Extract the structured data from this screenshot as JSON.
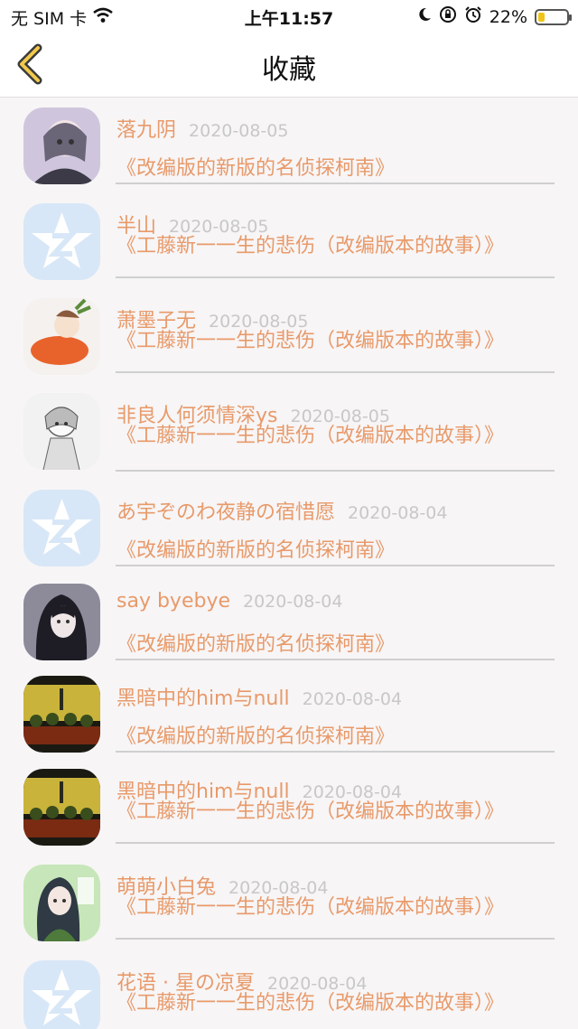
{
  "status_bar": {
    "carrier": "无 SIM 卡",
    "time": "上午11:57",
    "battery": "22%"
  },
  "nav": {
    "title": "收藏"
  },
  "items": [
    {
      "name": "落九阴",
      "date": "2020-08-05",
      "title": "《改编版的新版的名侦探柯南》",
      "avatar": "anime-girl-avatar"
    },
    {
      "name": "半山",
      "date": "2020-08-05",
      "title": "《工藤新一一生的悲伤（改编版本的故事）》",
      "avatar": "default-qq-avatar"
    },
    {
      "name": "萧墨子无",
      "date": "2020-08-05",
      "title": "《工藤新一一生的悲伤（改编版本的故事）》",
      "avatar": "carrot-avatar"
    },
    {
      "name": "非良人何须情深ys",
      "date": "2020-08-05",
      "title": "《工藤新一一生的悲伤（改编版本的故事）》",
      "avatar": "sketch-avatar"
    },
    {
      "name": "あ宇ぞのわ夜静の宿惜愿",
      "date": "2020-08-04",
      "title": "《改编版的新版的名侦探柯南》",
      "avatar": "default-qq-avatar"
    },
    {
      "name": "say byebye",
      "date": "2020-08-04",
      "title": "《改编版的新版的名侦探柯南》",
      "avatar": "dark-hair-avatar"
    },
    {
      "name": "黑暗中的him与null",
      "date": "2020-08-04",
      "title": "《改编版的新版的名侦探柯南》",
      "avatar": "table-scene-avatar"
    },
    {
      "name": "黑暗中的him与null",
      "date": "2020-08-04",
      "title": "《工藤新一一生的悲伤（改编版本的故事）》",
      "avatar": "table-scene-avatar"
    },
    {
      "name": "萌萌小白兔",
      "date": "2020-08-04",
      "title": "《工藤新一一生的悲伤（改编版本的故事）》",
      "avatar": "green-anime-avatar"
    },
    {
      "name": "花语 · 星の凉夏",
      "date": "2020-08-04",
      "title": "《工藤新一一生的悲伤（改编版本的故事）》",
      "avatar": "default-qq-avatar"
    }
  ]
}
